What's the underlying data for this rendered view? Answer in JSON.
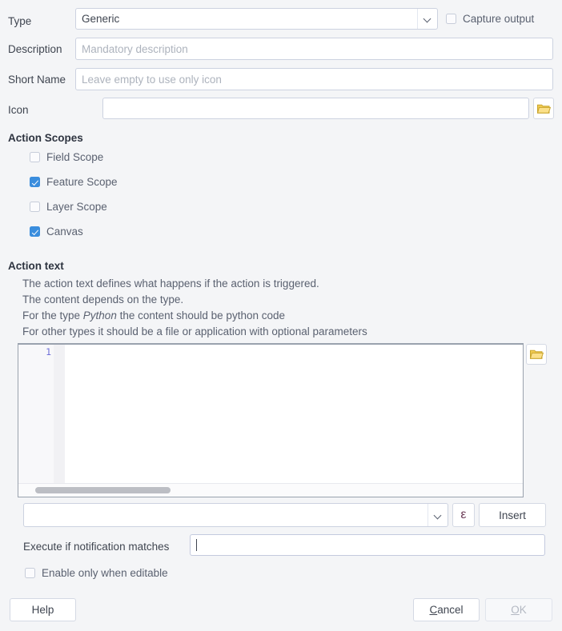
{
  "form": {
    "type": {
      "label": "Type",
      "value": "Generic"
    },
    "capture_output": {
      "label": "Capture output",
      "checked": false
    },
    "description": {
      "label": "Description",
      "value": "",
      "placeholder": "Mandatory description"
    },
    "short_name": {
      "label": "Short Name",
      "value": "",
      "placeholder": "Leave empty to use only icon"
    },
    "icon": {
      "label": "Icon",
      "value": "",
      "placeholder": "",
      "browse_icon": "folder-icon"
    }
  },
  "action_scopes": {
    "title": "Action Scopes",
    "items": [
      {
        "label": "Field Scope",
        "checked": false
      },
      {
        "label": "Feature Scope",
        "checked": true
      },
      {
        "label": "Layer Scope",
        "checked": false
      },
      {
        "label": "Canvas",
        "checked": true
      }
    ]
  },
  "action_text": {
    "title": "Action text",
    "lines": [
      "The action text defines what happens if the action is triggered.",
      "The content depends on the type.",
      "For other types it should be a file or application with optional parameters"
    ],
    "python_line": {
      "before": "For the type ",
      "emphasis": "Python",
      "after": " the content should be python code"
    },
    "editor": {
      "line_number": "1",
      "content": "",
      "browse_icon": "folder-icon"
    },
    "expression_combo": {
      "value": "",
      "placeholder": ""
    },
    "epsilon_button": {
      "label": "ε"
    },
    "insert_button": {
      "label": "Insert"
    }
  },
  "notification": {
    "label": "Execute if notification matches",
    "value": "",
    "placeholder": ""
  },
  "enable_only_when_editable": {
    "label": "Enable only when editable",
    "checked": false
  },
  "buttons": {
    "help": {
      "label": "Help"
    },
    "cancel": {
      "mnemonic": "C",
      "rest": "ancel"
    },
    "ok": {
      "mnemonic": "O",
      "rest": "K",
      "disabled": true
    }
  },
  "colors": {
    "background": "#f4f5f7",
    "accent_checkbox": "#3a8ddd",
    "line_number": "#6f6fd8",
    "epsilon": "#6b3b57",
    "folder": "#f2cc52"
  }
}
